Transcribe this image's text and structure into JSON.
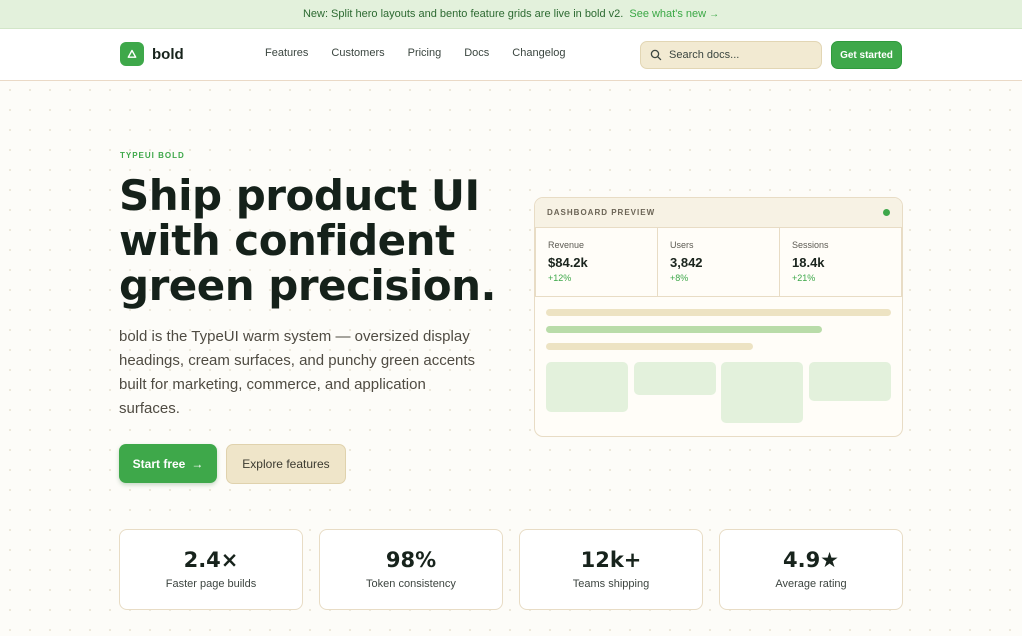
{
  "announcement": {
    "text": "New: Split hero layouts and bento feature grids are live in bold v2.",
    "link_label": "See what's new",
    "link_arrow": "→"
  },
  "nav": {
    "logo_text": "bold",
    "links": [
      "Features",
      "Customers",
      "Pricing",
      "Docs",
      "Changelog"
    ],
    "search_placeholder": "Search docs...",
    "cta_label": "Get started"
  },
  "hero": {
    "eyebrow": "TYPEUI BOLD",
    "title": "Ship product UI with confident green precision.",
    "subtitle": "bold is the TypeUI warm system — oversized display headings, cream surfaces, and punchy green accents built for marketing, commerce, and application surfaces.",
    "primary_button": "Start free",
    "primary_arrow": "→",
    "secondary_button": "Explore features"
  },
  "dashboard": {
    "label": "DASHBOARD PREVIEW",
    "metrics": [
      {
        "label": "Revenue",
        "value": "$84.2k",
        "delta": "+12%"
      },
      {
        "label": "Users",
        "value": "3,842",
        "delta": "+8%"
      },
      {
        "label": "Sessions",
        "value": "18.4k",
        "delta": "+21%"
      }
    ]
  },
  "stats": [
    {
      "value": "2.4×",
      "label": "Faster page builds"
    },
    {
      "value": "98%",
      "label": "Token consistency"
    },
    {
      "value": "12k+",
      "label": "Teams shipping"
    },
    {
      "value": "4.9★",
      "label": "Average rating"
    }
  ],
  "colors": {
    "accent": "#3ea84a",
    "cream": "#f2ead2",
    "announce_bg": "#e3f1dc",
    "text_dark": "#15211a"
  }
}
